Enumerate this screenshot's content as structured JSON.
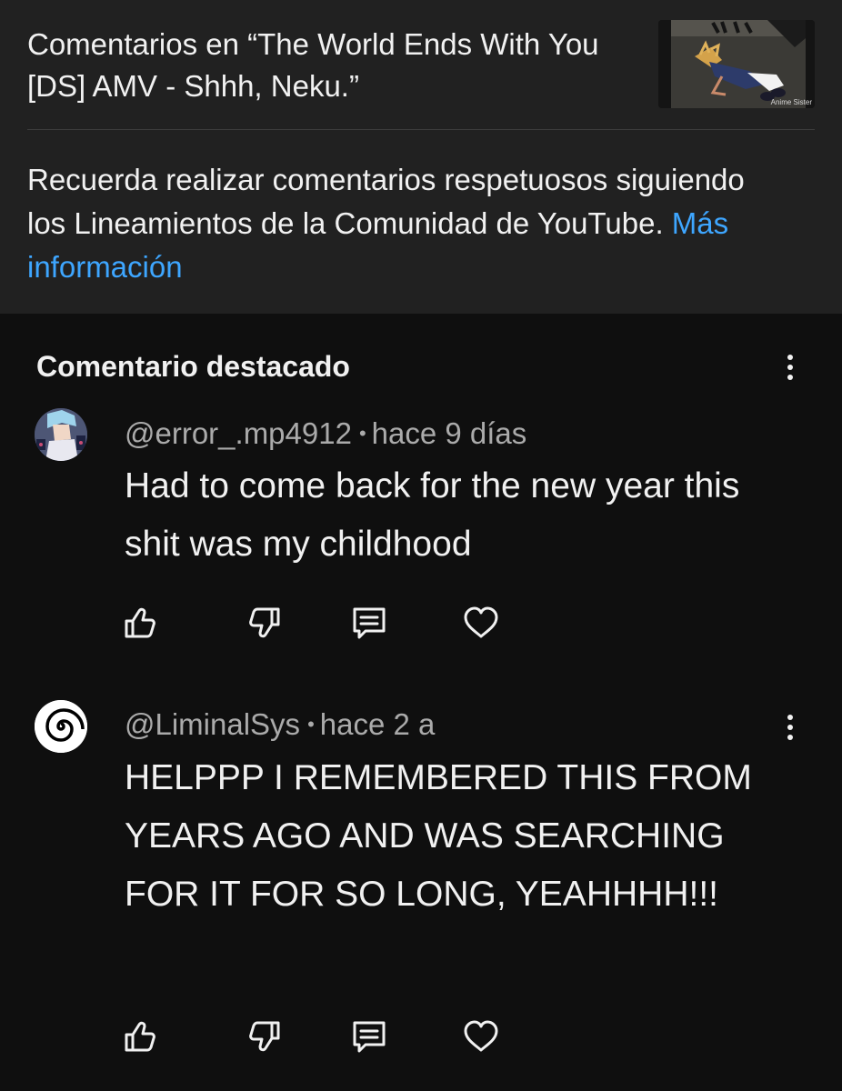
{
  "header": {
    "title": "Comentarios en “The World Ends With You [DS] AMV - Shhh, Neku.”",
    "thumbnail_watermark": "Anime Sister",
    "guidelines_text": "Recuerda realizar comentarios respetuosos siguiendo los Lineamientos de la Comunidad de YouTube.",
    "more_info_link": "Más información"
  },
  "featured": {
    "section_title": "Comentario destacado",
    "comment": {
      "author": "@error_.mp4912",
      "separator": "•",
      "time": "hace 9 días",
      "text": "Had to come back for the new year this shit was my childhood"
    }
  },
  "comments": [
    {
      "author": "@LiminalSys",
      "separator": "•",
      "time": "hace 2 a",
      "text": "HELPPP I REMEMBERED THIS FROM YEARS AGO AND WAS SEARCHING FOR IT FOR SO LONG, YEAHHHH!!!"
    }
  ],
  "icons": {
    "like": "thumbs-up-icon",
    "dislike": "thumbs-down-icon",
    "reply": "reply-icon",
    "heart": "heart-icon",
    "more": "more-vertical-icon"
  },
  "colors": {
    "header_bg": "#212121",
    "page_bg": "#0f0f0f",
    "link": "#3ea6ff",
    "text_primary": "#f1f1f1",
    "text_secondary": "#aaaaaa"
  }
}
